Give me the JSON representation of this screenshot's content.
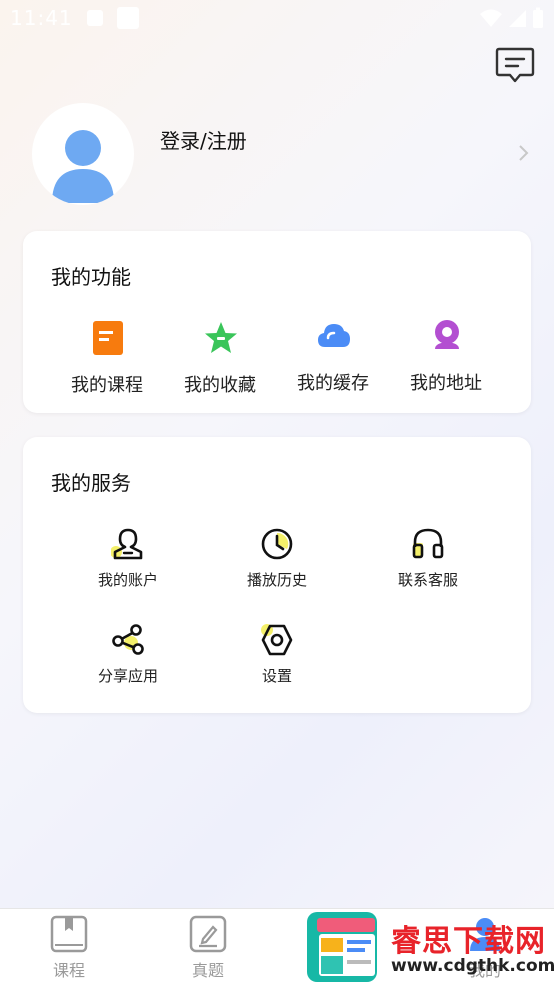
{
  "status_bar": {
    "time": "11:41"
  },
  "header": {
    "message_icon": "message-icon"
  },
  "profile": {
    "login_label": "登录/注册"
  },
  "functions": {
    "title": "我的功能",
    "items": [
      {
        "label": "我的课程",
        "icon": "course-book-icon",
        "color": "#f77b0e"
      },
      {
        "label": "我的收藏",
        "icon": "star-icon",
        "color": "#3ac55a"
      },
      {
        "label": "我的缓存",
        "icon": "cloud-icon",
        "color": "#4b8cf6"
      },
      {
        "label": "我的地址",
        "icon": "location-icon",
        "color": "#b34fd1"
      }
    ]
  },
  "services": {
    "title": "我的服务",
    "items": [
      {
        "label": "我的账户",
        "icon": "account-icon"
      },
      {
        "label": "播放历史",
        "icon": "history-clock-icon"
      },
      {
        "label": "联系客服",
        "icon": "headset-icon"
      },
      {
        "label": "分享应用",
        "icon": "share-icon"
      },
      {
        "label": "设置",
        "icon": "settings-icon"
      }
    ]
  },
  "bottom_nav": {
    "items": [
      {
        "label": "课程",
        "icon": "course-tab-icon"
      },
      {
        "label": "真题",
        "icon": "exam-tab-icon"
      },
      {
        "label": "我的",
        "icon": "mine-tab-icon"
      }
    ]
  },
  "watermark": {
    "title": "睿思下载网",
    "url": "www.cdgthk.com"
  }
}
